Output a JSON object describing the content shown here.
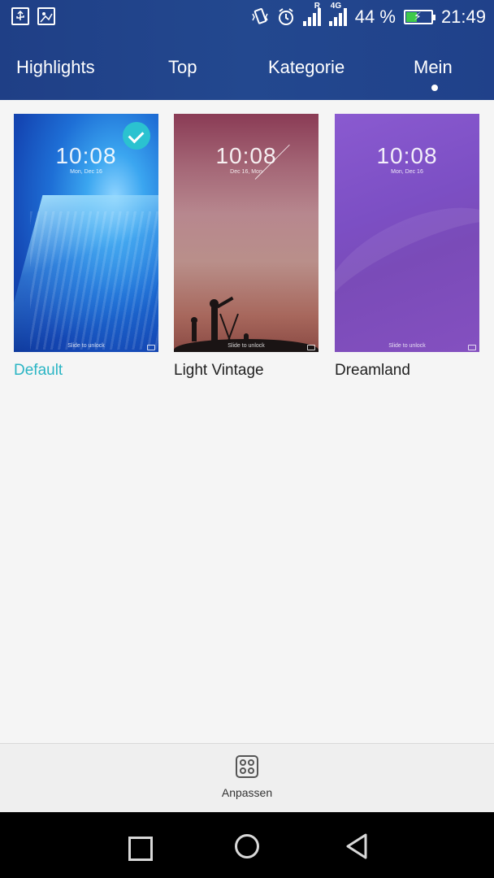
{
  "status_bar": {
    "battery_text": "44 %",
    "time": "21:49",
    "network_tag": "4G",
    "roaming_tag": "R",
    "battery_level": 0.44,
    "left_icons": [
      "usb-icon",
      "image-icon"
    ],
    "right_icons": [
      "vibrate-icon",
      "alarm-icon",
      "signal-icon",
      "signal-4g-icon",
      "battery-charging-icon"
    ]
  },
  "tabs": [
    {
      "label": "Highlights",
      "active": false
    },
    {
      "label": "Top",
      "active": false
    },
    {
      "label": "Kategorie",
      "active": false
    },
    {
      "label": "Mein",
      "active": true
    }
  ],
  "themes": [
    {
      "name": "Default",
      "selected": true,
      "preview_time": "10:08",
      "preview_date": "Mon, Dec 16",
      "preview_unlock": "Slide to unlock"
    },
    {
      "name": "Light Vintage",
      "selected": false,
      "preview_time": "10:08",
      "preview_date": "Dec 16,  Mon",
      "preview_unlock": "Slide to unlock"
    },
    {
      "name": "Dreamland",
      "selected": false,
      "preview_time": "10:08",
      "preview_date": "Mon, Dec 16",
      "preview_unlock": "Slide to unlock"
    }
  ],
  "bottom_bar": {
    "customize_label": "Anpassen",
    "customize_icon": "grid-customize-icon"
  },
  "nav_bar": {
    "icons": [
      "recent-apps-icon",
      "home-icon",
      "back-icon"
    ]
  },
  "colors": {
    "header": "#23488f",
    "accent": "#2bb5c4",
    "check": "#2bc2d0",
    "background": "#f5f5f5"
  }
}
